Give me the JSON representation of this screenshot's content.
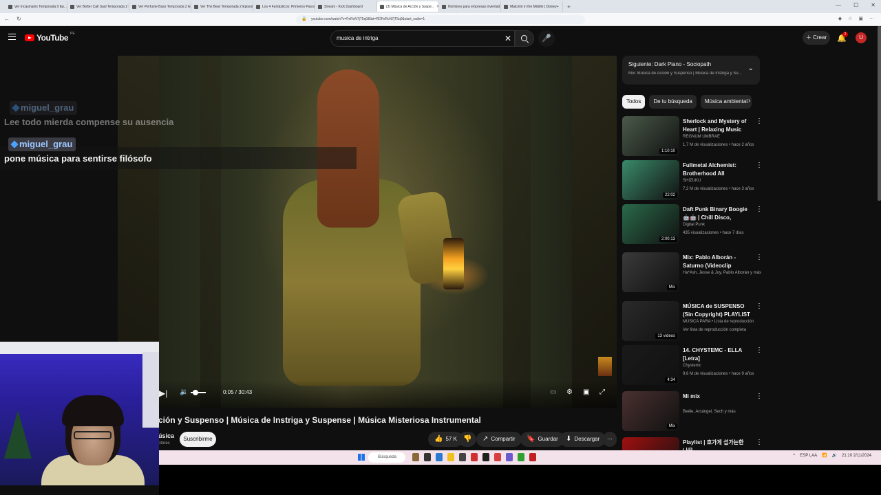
{
  "browser": {
    "tabs": [
      {
        "label": "Ver Incasinanis Temporada 0 Ep..."
      },
      {
        "label": "Ver Better Call Saul Temporada 2 Epi..."
      },
      {
        "label": "Ver Perfume Bass Temporada 2 Episo..."
      },
      {
        "label": "Ver The Bear Temporada 2 Episodio..."
      },
      {
        "label": "Los 4 Fantásticos: Primeros Pasos (..."
      },
      {
        "label": "Stream - Kick Dashboard"
      },
      {
        "label": "(3) Música de Acción y Suspe...",
        "active": true
      },
      {
        "label": "Nombres para empresas inventad..."
      },
      {
        "label": "Malcolm in the Middle | Disney+"
      }
    ],
    "url": "youtube.com/watch?v=FeRcN7jT5q0&list=RDFeRcN7jT5q0&start_radio=1"
  },
  "header": {
    "logo_text": "YouTube",
    "logo_country": "PE",
    "search_value": "musica de intriga",
    "create_label": "Crear",
    "notification_count": "2",
    "avatar_letter": "U"
  },
  "chat": {
    "messages": [
      {
        "user": "miguel_grau",
        "text": "Lee todo mierda compense su ausencia"
      },
      {
        "user": "miguel_grau",
        "text": "pone música para sentirse filósofo"
      }
    ]
  },
  "player": {
    "time": "0:05 / 30:43",
    "volume_level": 0.3
  },
  "video": {
    "title": "ción y Suspenso | Música de Instriga y Suspense | Música Misteriosa Instrumental",
    "channel": "úsica",
    "channel_sub": "otores",
    "subscribe_label": "Suscribirme",
    "likes": "57 K",
    "share_label": "Compartir",
    "save_label": "Guardar",
    "download_label": "Descargar"
  },
  "sidebar": {
    "up_next_title": "Siguiente: Dark Piano - Sociopath",
    "up_next_sub": "Mix: Música de Acción y Suspenso | Música de Instriga y Su...",
    "chips": [
      "Todos",
      "De tu búsqueda",
      "Música ambiental"
    ],
    "recs": [
      {
        "title": "Sherlock and Mystery of Heart | Relaxing Music for ...",
        "channel": "REGNUM UMBRAE",
        "meta": "1,7 M de visualizaciones • hace 2 años",
        "duration": "1:10:10",
        "color": "#4a5a4a"
      },
      {
        "title": "Fullmetal Alchemist: Brotherhood All Openings 1-5 ...",
        "channel": "SHIZUKU",
        "meta": "7,2 M de visualizaciones • hace 3 años",
        "duration": "22:02",
        "color": "#3a8a6a"
      },
      {
        "title": "Daft Punk Binary Boogie 🤖🤖 | Chill Disco, Synthwave, Synth ...",
        "channel": "Digital Punk",
        "meta": "435 visualizaciones • hace 7 días",
        "duration": "2:00:13",
        "color": "#2a6a4a"
      },
      {
        "title": "Mix: Pablo Alborán - Saturno (Videoclip Oficial)",
        "channel": "Ha*Ash, Jesse & Joy, Pablo Alborán y más",
        "meta": "",
        "duration": "Mix",
        "color": "#3a3a3a"
      },
      {
        "title": "MÚSICA de SUSPENSO (Sin Copyright) PLAYLIST",
        "channel": "MÚSICA PARA • Lista de reproducción",
        "meta": "Ver lista de reproducción completa",
        "duration": "13 videos",
        "color": "#2a2a2a"
      },
      {
        "title": "14. CHYSTEMC - ELLA [Letra]",
        "channel": "Chystemc",
        "meta": "9,6 M de visualizaciones • hace 9 años",
        "duration": "4:34",
        "color": "#1a1a1a"
      },
      {
        "title": "Mi mix",
        "channel": "Beéle, Arcángel, Sech y más",
        "meta": "",
        "duration": "Mix",
        "color": "#4a3030"
      },
      {
        "title": "Playlist | 호가게 섭가는한 나무 ...",
        "channel": "",
        "meta": "",
        "duration": "",
        "color": "#a01010"
      }
    ]
  },
  "taskbar": {
    "search_placeholder": "Búsqueda",
    "lang": "ESP LAA",
    "time": "21:10",
    "date": "2/11/2024"
  },
  "colors": {
    "accent": "#ff0000",
    "background": "#0f0f0f",
    "chip_bg": "#272727"
  }
}
